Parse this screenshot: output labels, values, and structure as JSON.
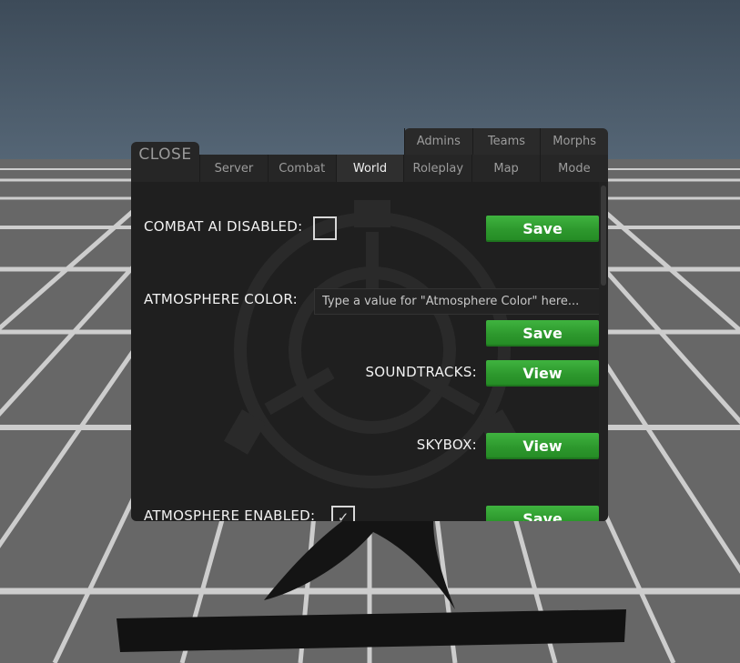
{
  "close_label": "CLOSE",
  "tabs_top": [
    "Admins",
    "Teams",
    "Morphs"
  ],
  "tabs_bottom": [
    "Server",
    "Combat",
    "World",
    "Roleplay",
    "Map",
    "Mode"
  ],
  "active_tab": "World",
  "settings": {
    "combat_ai": {
      "label": "COMBAT AI DISABLED:",
      "checked": false,
      "button": "Save"
    },
    "atmosphere_color": {
      "label": "ATMOSPHERE COLOR:",
      "placeholder": "Type a value for \"Atmosphere Color\" here...",
      "value": "",
      "button": "Save"
    },
    "soundtracks": {
      "label": "SOUNDTRACKS:",
      "button": "View"
    },
    "skybox": {
      "label": "SKYBOX:",
      "button": "View"
    },
    "atmosphere_enabled": {
      "label": "ATMOSPHERE ENABLED:",
      "checked": true,
      "button": "Save"
    }
  },
  "colors": {
    "sky": "#4a5a6a",
    "floor": "#6b6b6b",
    "grid_lines": "#e0e0e0",
    "panel_bg": "#1f1f1f",
    "button_green": "#34a234"
  },
  "icons": {
    "check": "check-icon",
    "logo": "scp-logo-watermark"
  }
}
